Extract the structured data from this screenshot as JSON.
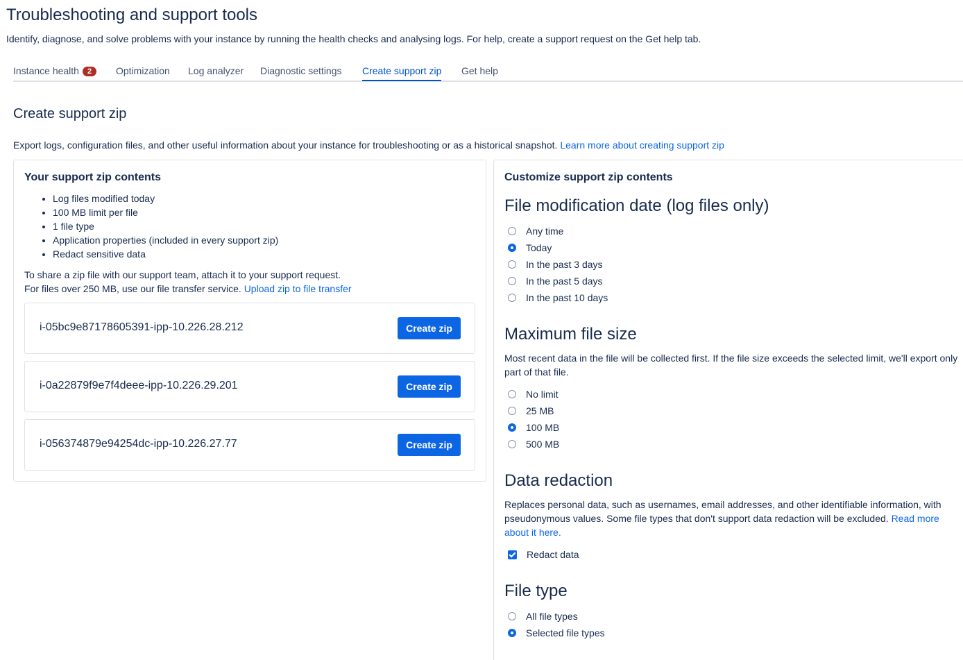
{
  "page": {
    "title": "Troubleshooting and support tools",
    "description": "Identify, diagnose, and solve problems with your instance by running the health checks and analysing logs. For help, create a support request on the Get help tab."
  },
  "tabs": [
    {
      "label": "Instance health",
      "badge": "2"
    },
    {
      "label": "Optimization"
    },
    {
      "label": "Log analyzer"
    },
    {
      "label": "Diagnostic settings"
    },
    {
      "label": "Create support zip",
      "active": true
    },
    {
      "label": "Get help"
    }
  ],
  "section": {
    "title": "Create support zip",
    "description": "Export logs, configuration files, and other useful information about your instance for troubleshooting or as a historical snapshot.",
    "learn_more": "Learn more about creating support zip"
  },
  "contents_panel": {
    "heading": "Your support zip contents",
    "items": [
      "Log files modified today",
      "100 MB limit per file",
      "1 file type",
      "Application properties (included in every support zip)",
      "Redact sensitive data"
    ],
    "share_line1": "To share a zip file with our support team, attach it to your support request.",
    "share_line2": "For files over 250 MB, use our file transfer service.",
    "upload_link": "Upload zip to file transfer",
    "nodes": [
      {
        "name": "i-05bc9e87178605391-ipp-10.226.28.212",
        "button": "Create zip"
      },
      {
        "name": "i-0a22879f9e7f4deee-ipp-10.226.29.201",
        "button": "Create zip"
      },
      {
        "name": "i-056374879e94254dc-ipp-10.226.27.77",
        "button": "Create zip"
      }
    ]
  },
  "customize_panel": {
    "heading": "Customize support zip contents",
    "file_date": {
      "title": "File modification date (log files only)",
      "options": [
        "Any time",
        "Today",
        "In the past 3 days",
        "In the past 5 days",
        "In the past 10 days"
      ],
      "selected": "Today"
    },
    "max_size": {
      "title": "Maximum file size",
      "description": "Most recent data in the file will be collected first. If the file size exceeds the selected limit, we'll export only part of that file.",
      "options": [
        "No limit",
        "25 MB",
        "100 MB",
        "500 MB"
      ],
      "selected": "100 MB"
    },
    "redaction": {
      "title": "Data redaction",
      "description": "Replaces personal data, such as usernames, email addresses, and other identifiable information, with pseudonymous values. Some file types that don't support data redaction will be excluded.",
      "read_more": "Read more about it here.",
      "checkbox_label": "Redact data",
      "checked": true
    },
    "file_type": {
      "title": "File type",
      "options": [
        "All file types",
        "Selected file types"
      ],
      "selected": "Selected file types"
    }
  },
  "colors": {
    "accent": "#0c66e4",
    "badge": "#ae2e24",
    "text": "#172b4d",
    "border": "#dfe1e6"
  }
}
